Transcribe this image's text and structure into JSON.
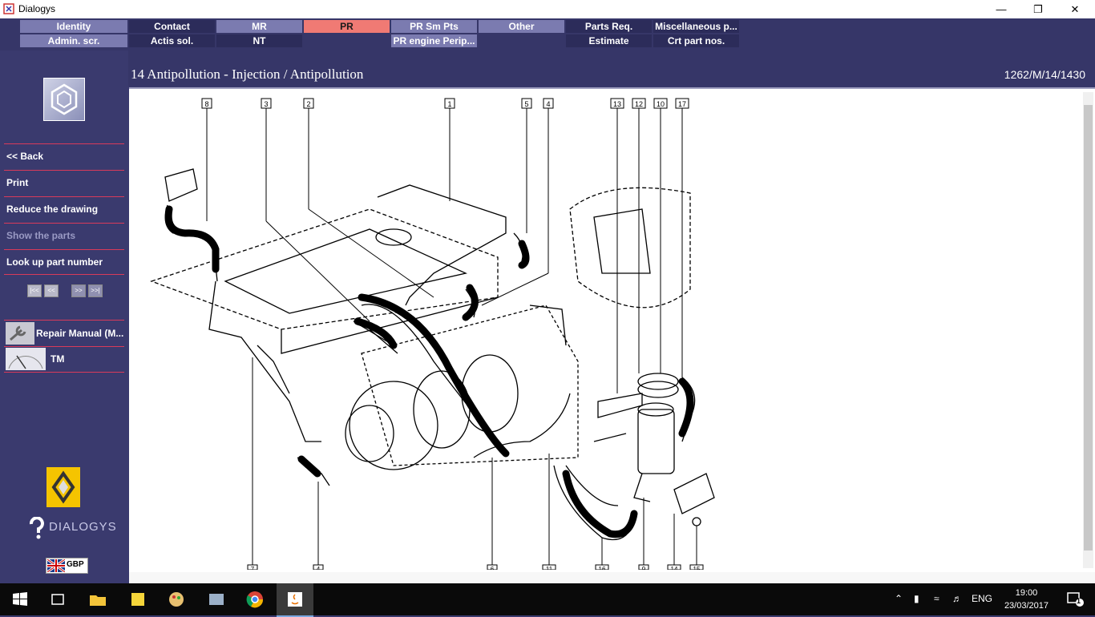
{
  "window": {
    "title": "Dialogys"
  },
  "tabs_row1": [
    {
      "label": "Identity",
      "style": "light"
    },
    {
      "label": "Contact",
      "style": "dark"
    },
    {
      "label": "MR",
      "style": "light"
    },
    {
      "label": "PR",
      "style": "active"
    },
    {
      "label": "PR Sm Pts",
      "style": "light"
    },
    {
      "label": "Other",
      "style": "light"
    },
    {
      "label": "Parts Req.",
      "style": "dark"
    },
    {
      "label": "Miscellaneous p...",
      "style": "dark"
    }
  ],
  "tabs_row2": [
    {
      "label": "Admin. scr.",
      "style": "light"
    },
    {
      "label": "Actis sol.",
      "style": "dark"
    },
    {
      "label": "NT",
      "style": "dark"
    },
    {
      "label": "PR engine Perip...",
      "style": "light"
    },
    {
      "label": "Estimate",
      "style": "dark"
    },
    {
      "label": "Crt part nos.",
      "style": "dark"
    }
  ],
  "sidebar": {
    "back": "<< Back",
    "print": "Print",
    "reduce": "Reduce the drawing",
    "show_parts": "Show the parts",
    "lookup": "Look up part number",
    "pager": [
      "|<<",
      "<<",
      ">>",
      ">>|"
    ],
    "docs": [
      {
        "label": "Repair Manual (M..."
      },
      {
        "label": "TM"
      }
    ],
    "brand": "DIALOGYS",
    "currency": "GBP"
  },
  "header": {
    "title": "14 Antipollution - Injection / Antipollution",
    "ref": "1262/M/14/1430"
  },
  "callouts_top": [
    "8",
    "3",
    "2",
    "1",
    "5",
    "4",
    "13",
    "12",
    "10",
    "17"
  ],
  "callouts_bottom": [
    "7",
    "4",
    "6",
    "11",
    "16",
    "9",
    "14",
    "15"
  ],
  "taskbar": {
    "lang": "ENG",
    "time": "19:00",
    "date": "23/03/2017",
    "notifications": "1"
  }
}
